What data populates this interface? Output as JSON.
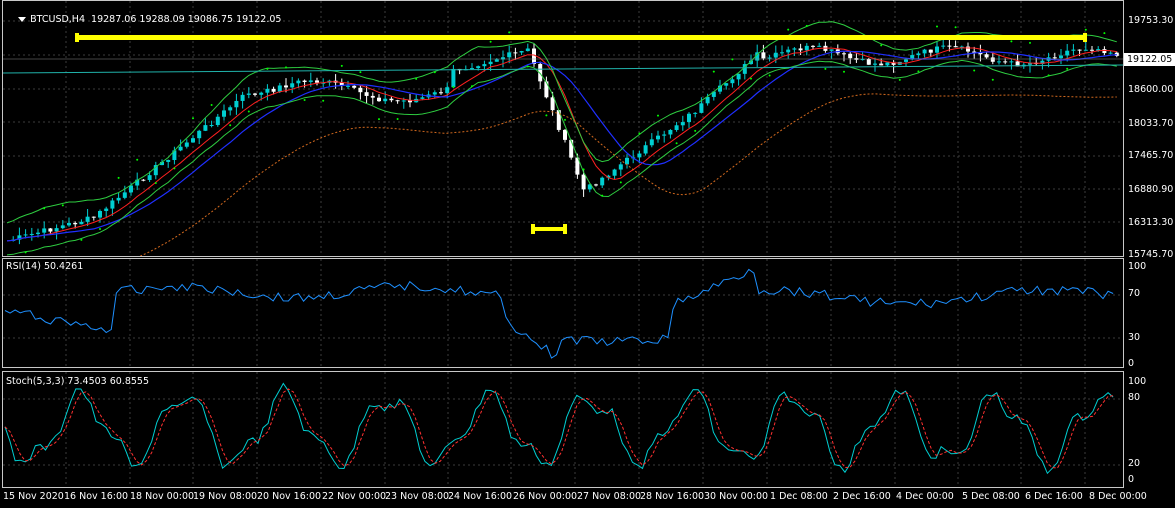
{
  "main": {
    "symbol": "BTCUSD,H4",
    "ohlc": "19287.06 19288.09 19086.75 19122.05",
    "current_price": "19122.05",
    "price_axis": [
      "19753.30",
      "18600.00",
      "18033.70",
      "17465.70",
      "16880.90",
      "16313.30",
      "15745.70"
    ]
  },
  "rsi": {
    "label": "RSI(14) 50.4261",
    "axis": [
      "100",
      "70",
      "30",
      "0"
    ]
  },
  "stoch": {
    "label": "Stoch(5,3,3) 73.4503 60.8555",
    "axis": [
      "100",
      "80",
      "20",
      "0"
    ]
  },
  "time_axis": [
    "15 Nov 2020",
    "16 Nov 16:00",
    "18 Nov 00:00",
    "19 Nov 08:00",
    "20 Nov 16:00",
    "22 Nov 00:00",
    "23 Nov 08:00",
    "24 Nov 16:00",
    "26 Nov 00:00",
    "27 Nov 08:00",
    "28 Nov 16:00",
    "30 Nov 00:00",
    "1 Dec 08:00",
    "2 Dec 16:00",
    "4 Dec 00:00",
    "5 Dec 08:00",
    "6 Dec 16:00",
    "8 Dec 00:00"
  ],
  "colors": {
    "background": "#000000",
    "grid": "#3c3c3c",
    "bull_candle": "#00ced1",
    "bear_candle": "#ffffff",
    "level_lines": "#ffff00",
    "rsi_line": "#1e90ff",
    "stoch_main": "#00ced1",
    "stoch_signal": "#ff3030"
  }
}
